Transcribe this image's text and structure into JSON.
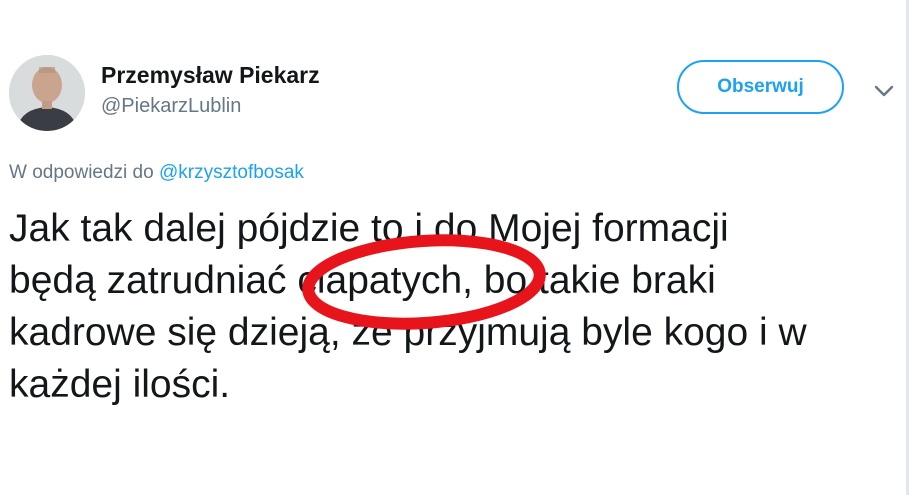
{
  "tweet": {
    "author": {
      "display_name": "Przemysław Piekarz",
      "handle": "@PiekarzLublin"
    },
    "follow_button_label": "Obserwuj",
    "reply_context": {
      "prefix": "W odpowiedzi do",
      "mention": "@krzysztofbosak"
    },
    "text_lines": [
      "Jak tak dalej pójdzie to i do Mojej formacji",
      "będą zatrudniać ciapatych, bo takie braki",
      "kadrowe się dzieją, że przyjmują byle kogo i w",
      "każdej ilości."
    ],
    "highlighted_word": "ciapatych"
  },
  "colors": {
    "accent": "#1da1f2",
    "secondary_text": "#657786",
    "primary_text": "#14171a",
    "highlight_stroke": "#e8141c"
  },
  "icons": {
    "menu": "chevron-down-icon",
    "avatar": "avatar"
  }
}
